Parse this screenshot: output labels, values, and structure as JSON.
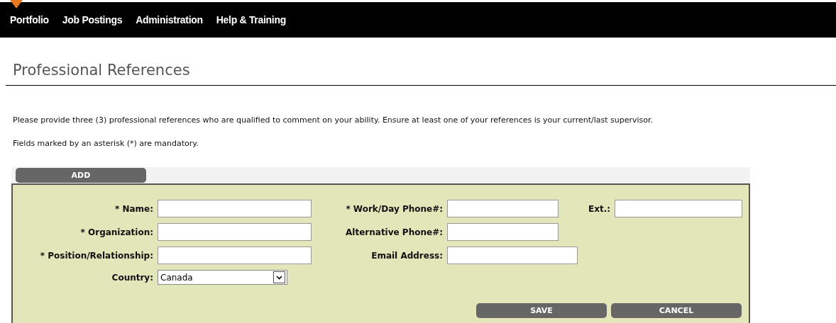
{
  "nav": {
    "items": [
      {
        "label": "Portfolio"
      },
      {
        "label": "Job Postings"
      },
      {
        "label": "Administration"
      },
      {
        "label": "Help & Training"
      }
    ]
  },
  "title": "Professional References",
  "instructions": [
    "Please provide three (3) professional references who are qualified to comment on your ability. Ensure at least one of your references is your current/last supervisor.",
    "Fields marked by an asterisk (*) are mandatory."
  ],
  "add_button": "ADD",
  "form": {
    "rows": [
      [
        {
          "label": "* Name:",
          "kind": "text"
        },
        {
          "label": "* Work/Day Phone#:",
          "kind": "text"
        },
        {
          "label": "Ext.:",
          "kind": "text"
        }
      ],
      [
        {
          "label": "* Organization:",
          "kind": "text"
        },
        {
          "label": "Alternative Phone#:",
          "kind": "text"
        }
      ],
      [
        {
          "label": "* Position/Relationship:",
          "kind": "text"
        },
        {
          "label": "Email Address:",
          "kind": "email"
        }
      ],
      [
        {
          "label": "Country:",
          "kind": "select",
          "value": "Canada"
        }
      ]
    ],
    "buttons": [
      "SAVE",
      "CANCEL"
    ]
  }
}
